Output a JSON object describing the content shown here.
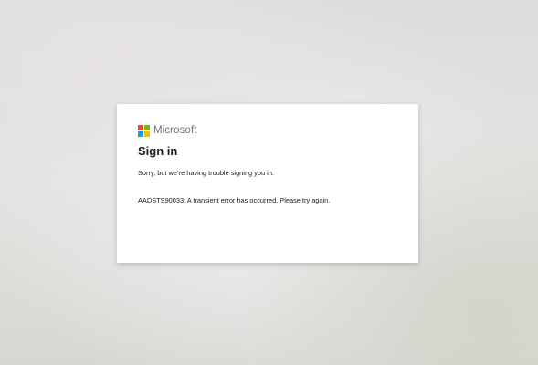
{
  "brand": {
    "name": "Microsoft",
    "logo_icon": "microsoft-logo-icon",
    "logo_colors": [
      "#f25022",
      "#7fba00",
      "#00a4ef",
      "#ffb900"
    ]
  },
  "dialog": {
    "title": "Sign in",
    "message": "Sorry, but we’re having trouble signing you in.",
    "error": "AADSTS90033: A transient error has occurred. Please try again."
  }
}
